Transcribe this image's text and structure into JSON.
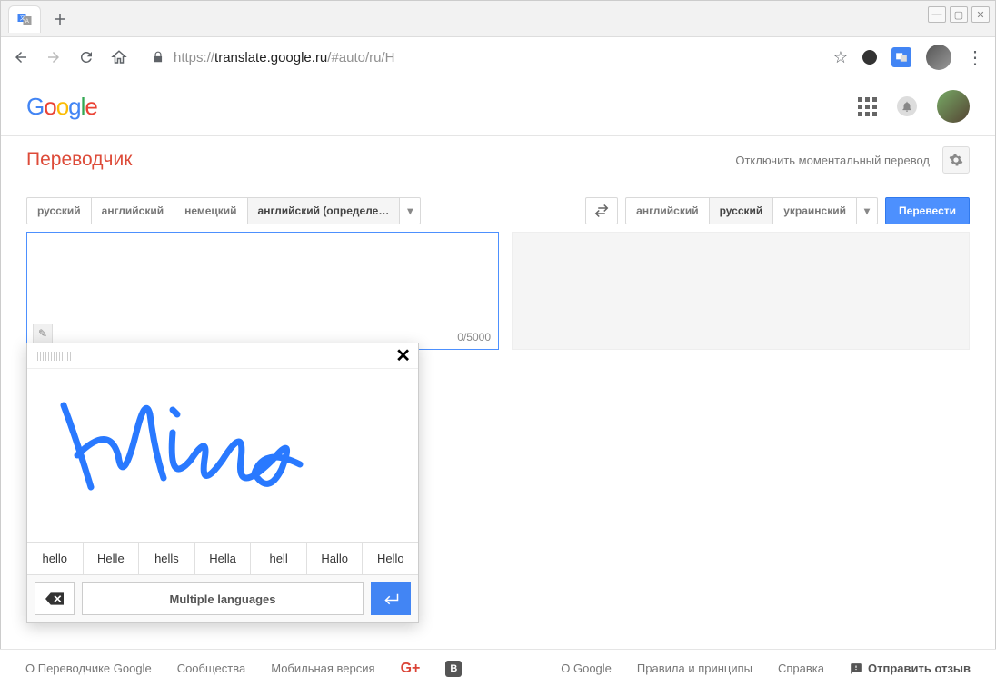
{
  "browser": {
    "url_prefix": "https://",
    "url_host": "translate.google.ru",
    "url_path": "/#auto/ru/H"
  },
  "header": {
    "app_name": "Переводчик",
    "instant_toggle": "Отключить моментальный перевод"
  },
  "source_langs": {
    "items": [
      "русский",
      "английский",
      "немецкий",
      "английский (определе…"
    ],
    "active_index": 3
  },
  "target_langs": {
    "items": [
      "английский",
      "русский",
      "украинский"
    ],
    "active_index": 1
  },
  "translate_button": "Перевести",
  "char_counter": "0/5000",
  "handwriting": {
    "suggestions": [
      "hello",
      "Helle",
      "hells",
      "Hella",
      "hell",
      "Hallo",
      "Hello"
    ],
    "lang_button": "Multiple languages"
  },
  "footer": {
    "about": "О Переводчике Google",
    "community": "Сообщества",
    "mobile": "Мобильная версия",
    "about_google": "О Google",
    "privacy": "Правила и принципы",
    "help": "Справка",
    "feedback": "Отправить отзыв"
  }
}
